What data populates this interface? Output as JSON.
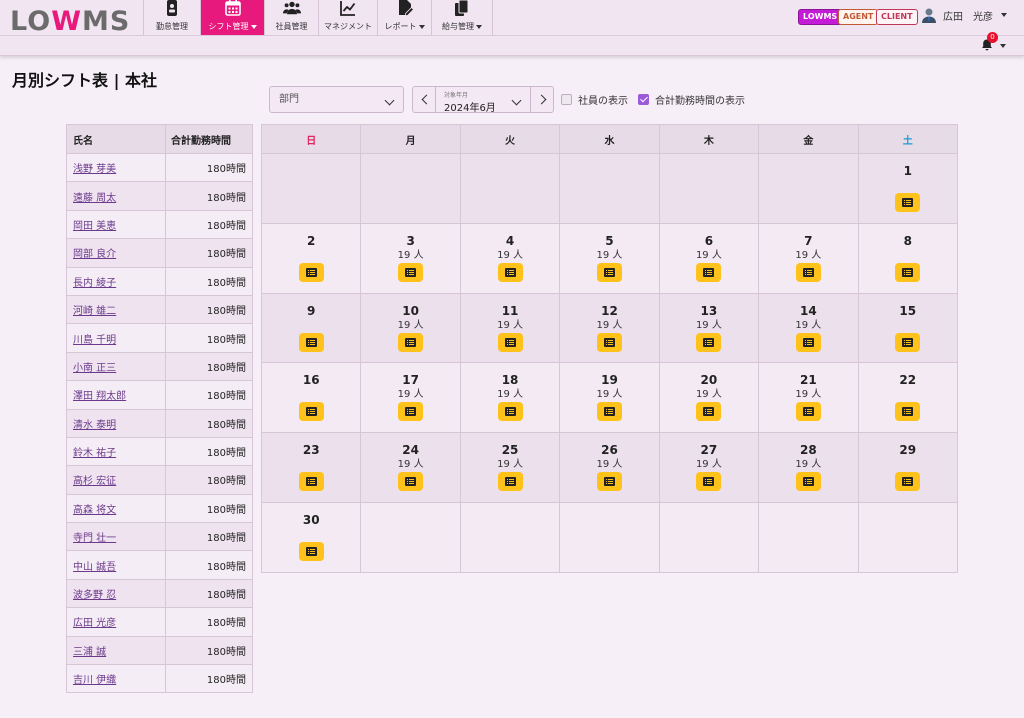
{
  "header": {
    "logo": {
      "pre": "LO",
      "mid": "W",
      "post": "MS"
    },
    "nav": [
      {
        "label": "勤怠管理",
        "icon": "id-card-icon",
        "width": 57,
        "active": false,
        "dropdown": false
      },
      {
        "label": "シフト管理",
        "icon": "calendar-icon",
        "width": 64,
        "active": true,
        "dropdown": true
      },
      {
        "label": "社員管理",
        "icon": "users-icon",
        "width": 54,
        "active": false,
        "dropdown": false
      },
      {
        "label": "マネジメント",
        "icon": "chart-line-icon",
        "width": 59,
        "active": false,
        "dropdown": false
      },
      {
        "label": "レポート",
        "icon": "file-edit-icon",
        "width": 54,
        "active": false,
        "dropdown": true
      },
      {
        "label": "給与管理",
        "icon": "copy-icon",
        "width": 62,
        "active": false,
        "dropdown": true
      }
    ],
    "badges": {
      "lowms": "LOWMS",
      "agent": "AGENT",
      "client": "CLIENT"
    },
    "user_name": "広田　光彦",
    "notification_count": "0"
  },
  "page": {
    "title": "月別シフト表 | 本社",
    "dept_placeholder": "部門",
    "month_label": "対象年月",
    "month_value": "2024年6月",
    "show_staff_label": "社員の表示",
    "show_hours_label": "合計勤務時間の表示",
    "show_staff_checked": false,
    "show_hours_checked": true
  },
  "staff_table": {
    "headers": {
      "name": "氏名",
      "hours": "合計勤務時間"
    },
    "rows": [
      {
        "name": "浅野 芽美",
        "hours": "180時間"
      },
      {
        "name": "遠藤 周太",
        "hours": "180時間"
      },
      {
        "name": "岡田 美恵",
        "hours": "180時間"
      },
      {
        "name": "岡部 良介",
        "hours": "180時間"
      },
      {
        "name": "長内 綾子",
        "hours": "180時間"
      },
      {
        "name": "河崎 雄二",
        "hours": "180時間"
      },
      {
        "name": "川島 千明",
        "hours": "180時間"
      },
      {
        "name": "小南 正三",
        "hours": "180時間"
      },
      {
        "name": "澤田 翔太郎",
        "hours": "180時間"
      },
      {
        "name": "清水 泰明",
        "hours": "180時間"
      },
      {
        "name": "鈴木 祐子",
        "hours": "180時間"
      },
      {
        "name": "高杉 宏征",
        "hours": "180時間"
      },
      {
        "name": "高森 将文",
        "hours": "180時間"
      },
      {
        "name": "寺門 壮一",
        "hours": "180時間"
      },
      {
        "name": "中山 誠吾",
        "hours": "180時間"
      },
      {
        "name": "波多野 忍",
        "hours": "180時間"
      },
      {
        "name": "広田 光彦",
        "hours": "180時間"
      },
      {
        "name": "三浦 誠",
        "hours": "180時間"
      },
      {
        "name": "吉川 伊織",
        "hours": "180時間"
      }
    ]
  },
  "calendar": {
    "weekdays": [
      "日",
      "月",
      "火",
      "水",
      "木",
      "金",
      "土"
    ],
    "count_suffix": " 人",
    "weeks": [
      [
        null,
        null,
        null,
        null,
        null,
        null,
        {
          "day": 1,
          "count": null
        }
      ],
      [
        {
          "day": 2,
          "count": null
        },
        {
          "day": 3,
          "count": 19
        },
        {
          "day": 4,
          "count": 19
        },
        {
          "day": 5,
          "count": 19
        },
        {
          "day": 6,
          "count": 19
        },
        {
          "day": 7,
          "count": 19
        },
        {
          "day": 8,
          "count": null
        }
      ],
      [
        {
          "day": 9,
          "count": null
        },
        {
          "day": 10,
          "count": 19
        },
        {
          "day": 11,
          "count": 19
        },
        {
          "day": 12,
          "count": 19
        },
        {
          "day": 13,
          "count": 19
        },
        {
          "day": 14,
          "count": 19
        },
        {
          "day": 15,
          "count": null
        }
      ],
      [
        {
          "day": 16,
          "count": null
        },
        {
          "day": 17,
          "count": 19
        },
        {
          "day": 18,
          "count": 19
        },
        {
          "day": 19,
          "count": 19
        },
        {
          "day": 20,
          "count": 19
        },
        {
          "day": 21,
          "count": 19
        },
        {
          "day": 22,
          "count": null
        }
      ],
      [
        {
          "day": 23,
          "count": null
        },
        {
          "day": 24,
          "count": 19
        },
        {
          "day": 25,
          "count": 19
        },
        {
          "day": 26,
          "count": 19
        },
        {
          "day": 27,
          "count": 19
        },
        {
          "day": 28,
          "count": 19
        },
        {
          "day": 29,
          "count": null
        }
      ],
      [
        {
          "day": 30,
          "count": null
        },
        null,
        null,
        null,
        null,
        null,
        null
      ]
    ]
  }
}
